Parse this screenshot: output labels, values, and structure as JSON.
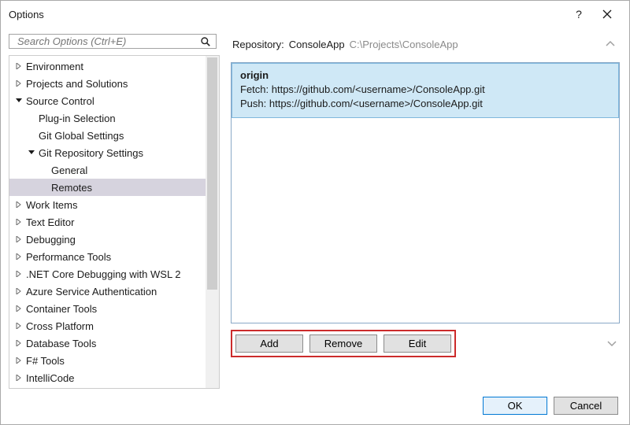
{
  "window": {
    "title": "Options",
    "help_label": "?",
    "close_label": "✕"
  },
  "search": {
    "placeholder": "Search Options (Ctrl+E)"
  },
  "tree": {
    "n0": "Environment",
    "n1": "Projects and Solutions",
    "n2": "Source Control",
    "n2a": "Plug-in Selection",
    "n2b": "Git Global Settings",
    "n2c": "Git Repository Settings",
    "n2c1": "General",
    "n2c2": "Remotes",
    "n3": "Work Items",
    "n4": "Text Editor",
    "n5": "Debugging",
    "n6": "Performance Tools",
    "n7": ".NET Core Debugging with WSL 2",
    "n8": "Azure Service Authentication",
    "n9": "Container Tools",
    "n10": "Cross Platform",
    "n11": "Database Tools",
    "n12": "F# Tools",
    "n13": "IntelliCode"
  },
  "repo": {
    "label": "Repository:",
    "name": "ConsoleApp",
    "path": "C:\\Projects\\ConsoleApp"
  },
  "remotes": [
    {
      "name": "origin",
      "fetch_label": "Fetch:",
      "fetch_url": "https://github.com/<username>/ConsoleApp.git",
      "push_label": "Push:",
      "push_url": "https://github.com/<username>/ConsoleApp.git"
    }
  ],
  "buttons": {
    "add": "Add",
    "remove": "Remove",
    "edit": "Edit",
    "ok": "OK",
    "cancel": "Cancel"
  }
}
